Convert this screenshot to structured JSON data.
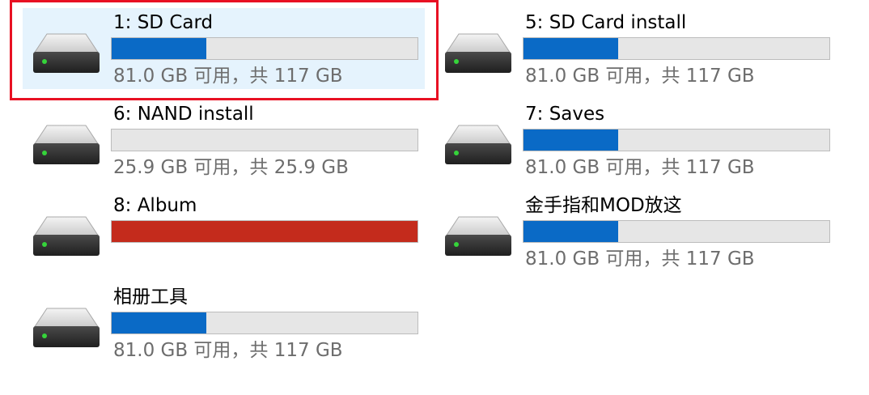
{
  "drives": [
    {
      "id": "sd-card",
      "name": "1: SD Card",
      "space": "81.0 GB 可用，共 117 GB",
      "used_fraction": 0.31,
      "bar_color": "blue",
      "selected": true
    },
    {
      "id": "sd-card-install",
      "name": "5: SD Card install",
      "space": "81.0 GB 可用，共 117 GB",
      "used_fraction": 0.31,
      "bar_color": "blue",
      "selected": false
    },
    {
      "id": "nand-install",
      "name": "6: NAND install",
      "space": "25.9 GB 可用，共 25.9 GB",
      "used_fraction": 0.0,
      "bar_color": "blue",
      "selected": false
    },
    {
      "id": "saves",
      "name": "7: Saves",
      "space": "81.0 GB 可用，共 117 GB",
      "used_fraction": 0.31,
      "bar_color": "blue",
      "selected": false
    },
    {
      "id": "album",
      "name": "8: Album",
      "space": "",
      "used_fraction": 1.0,
      "bar_color": "red",
      "selected": false
    },
    {
      "id": "cheats-mod",
      "name": "金手指和MOD放这",
      "space": "81.0 GB 可用，共 117 GB",
      "used_fraction": 0.31,
      "bar_color": "blue",
      "selected": false
    },
    {
      "id": "album-tools",
      "name": "相册工具",
      "space": "81.0 GB 可用，共 117 GB",
      "used_fraction": 0.31,
      "bar_color": "blue",
      "selected": false
    }
  ],
  "colors": {
    "usage_blue": "#0a6ac6",
    "usage_red": "#c42b1c",
    "selection_outline": "#e81123",
    "selection_bg": "#e5f3fd"
  },
  "icon": "hard-drive-icon"
}
